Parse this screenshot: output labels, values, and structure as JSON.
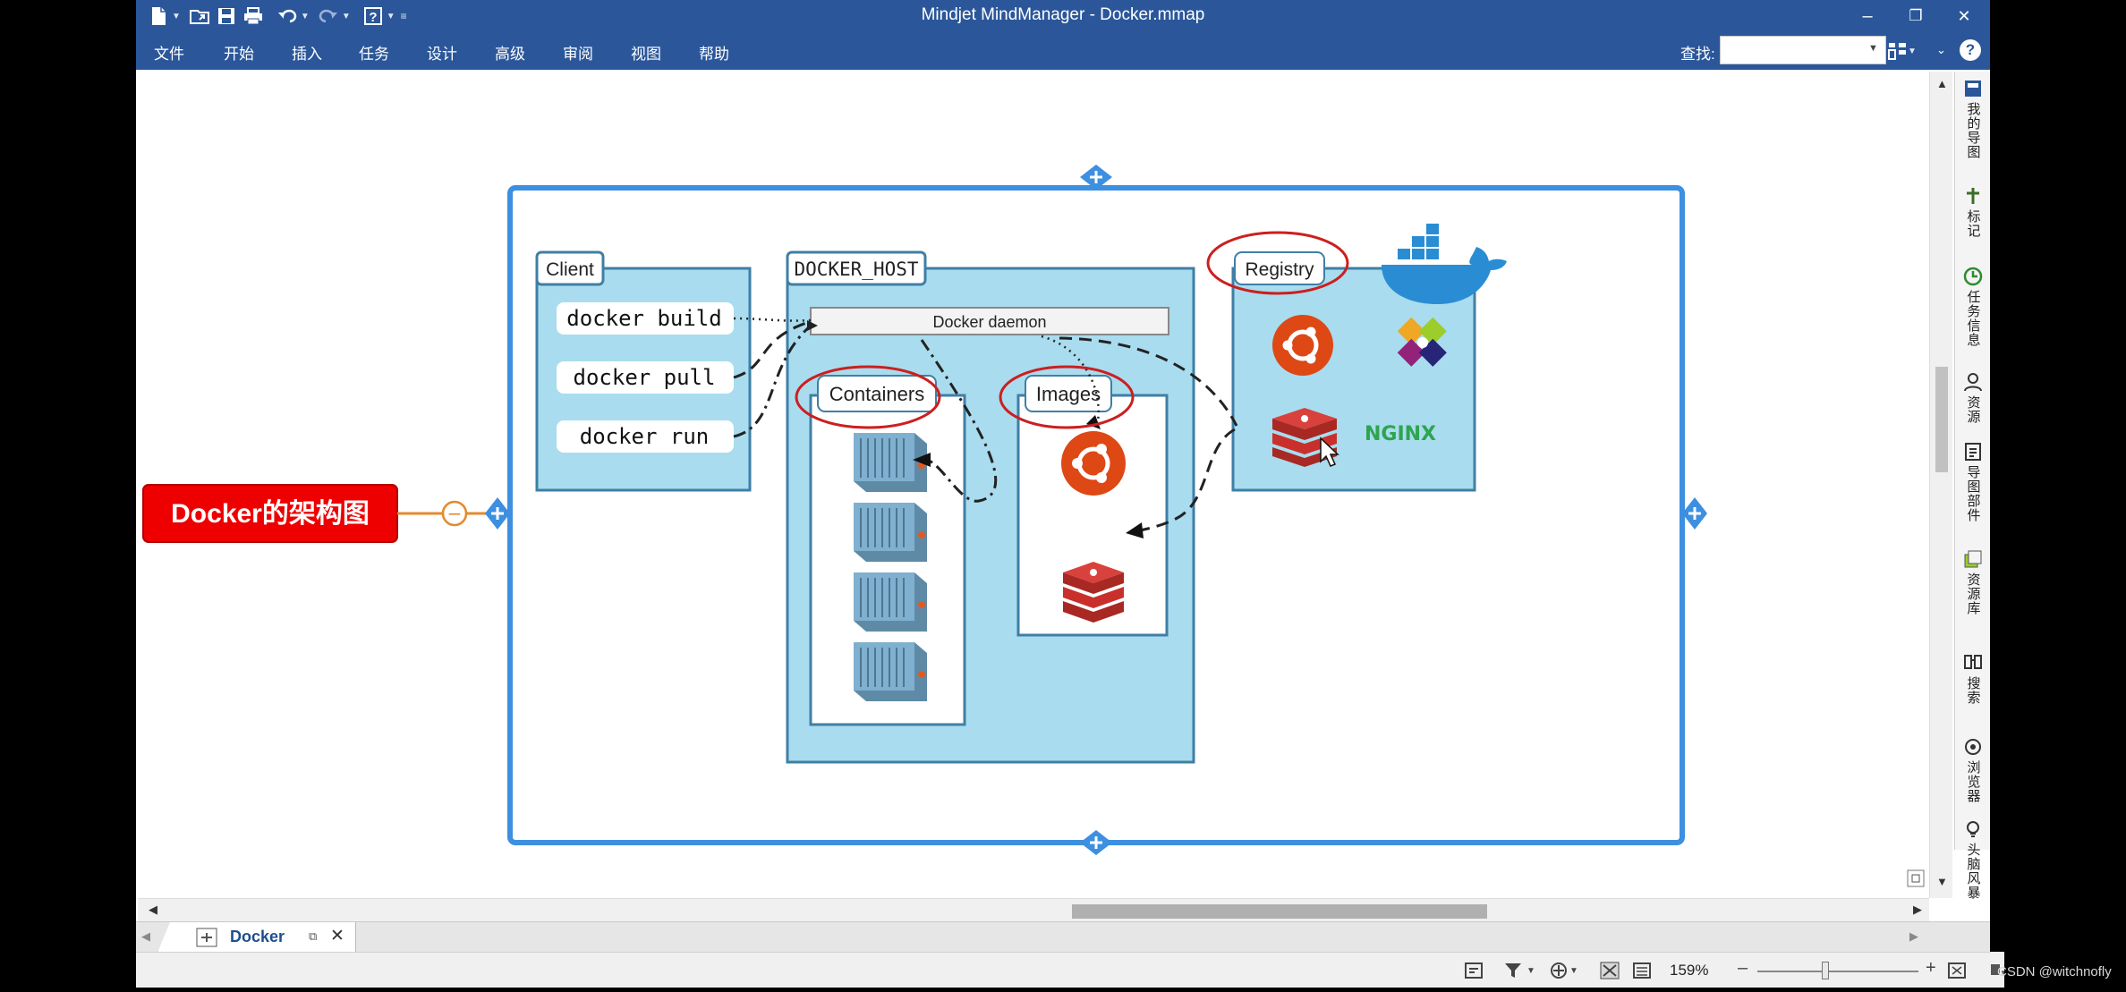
{
  "window": {
    "title": "Mindjet MindManager - Docker.mmap",
    "minimize": "–",
    "restore": "❐",
    "close": "✕"
  },
  "ribbon": {
    "menu": [
      "文件",
      "开始",
      "插入",
      "任务",
      "设计",
      "高级",
      "审阅",
      "视图",
      "帮助"
    ],
    "find_label": "查找:",
    "find_value": ""
  },
  "map": {
    "central_topic": "Docker的架构图",
    "collapse_symbol": "−",
    "image": {
      "client_label": "Client",
      "commands": [
        "docker build",
        "docker pull",
        "docker run"
      ],
      "host_label": "DOCKER_HOST",
      "daemon_label": "Docker daemon",
      "containers_label": "Containers",
      "images_label": "Images",
      "registry_label": "Registry",
      "nginx_label": "NGINX"
    }
  },
  "right_panel": [
    "我的导图",
    "标记",
    "任务信息",
    "资源",
    "导图部件",
    "资源库",
    "搜索",
    "浏览器",
    "头脑风暴"
  ],
  "tabs": [
    {
      "label": "Docker"
    }
  ],
  "status": {
    "zoom": "159%",
    "zoom_level": 0.42
  },
  "watermark": "CSDN @witchnofly",
  "colors": {
    "chrome": "#2b579a",
    "topic_red": "#ee0000",
    "frame_blue": "#3d8fe0",
    "box_fill": "#a9dcee",
    "box_stroke": "#3f7fa5",
    "annotation_red": "#cc1f1f",
    "ubuntu_orange": "#dd4814",
    "redis_red": "#c9302c",
    "nginx_green": "#2ea44f"
  }
}
